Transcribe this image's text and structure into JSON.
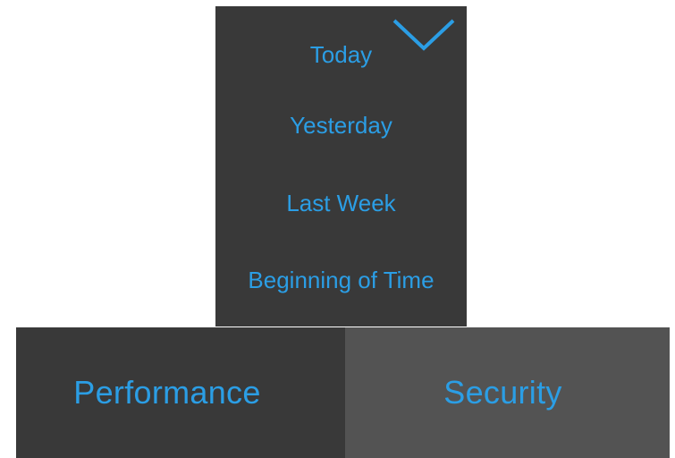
{
  "dropdown": {
    "toggle_icon": "chevron-down-icon",
    "options": [
      "Today",
      "Yesterday",
      "Last Week",
      "Beginning of Time"
    ]
  },
  "tabs": [
    {
      "label": "Performance",
      "selected": false
    },
    {
      "label": "Security",
      "selected": true
    }
  ],
  "colors": {
    "accent": "#2b9ee5",
    "panel_dark": "#393939",
    "panel_selected": "#535353",
    "background": "#ffffff"
  }
}
